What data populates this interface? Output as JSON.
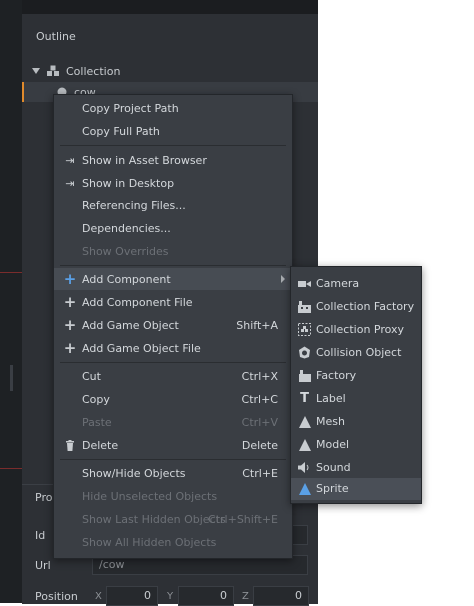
{
  "outline": {
    "title": "Outline",
    "collection_label": "Collection",
    "cow_label": "cow"
  },
  "properties": {
    "title": "Pro",
    "id_label": "Id",
    "url_label": "Url",
    "url_value": "/cow",
    "position_label": "Position",
    "x_label": "X",
    "y_label": "Y",
    "z_label": "Z",
    "x_value": "0",
    "y_value": "0",
    "z_value": "0"
  },
  "context_menu": {
    "copy_project_path": "Copy Project Path",
    "copy_full_path": "Copy Full Path",
    "show_in_asset_browser": "Show in Asset Browser",
    "show_in_desktop": "Show in Desktop",
    "referencing_files": "Referencing Files...",
    "dependencies": "Dependencies...",
    "show_overrides": "Show Overrides",
    "add_component": "Add Component",
    "add_component_file": "Add Component File",
    "add_game_object": "Add Game Object",
    "add_game_object_shortcut": "Shift+A",
    "add_game_object_file": "Add Game Object File",
    "cut": "Cut",
    "cut_shortcut": "Ctrl+X",
    "copy": "Copy",
    "copy_shortcut": "Ctrl+C",
    "paste": "Paste",
    "paste_shortcut": "Ctrl+V",
    "delete": "Delete",
    "delete_shortcut": "Delete",
    "show_hide_objects": "Show/Hide Objects",
    "show_hide_shortcut": "Ctrl+E",
    "hide_unselected": "Hide Unselected Objects",
    "show_last_hidden": "Show Last Hidden Objects",
    "show_last_hidden_shortcut": "Ctrl+Shift+E",
    "show_all_hidden": "Show All Hidden Objects"
  },
  "submenu": {
    "camera": "Camera",
    "collection_factory": "Collection Factory",
    "collection_proxy": "Collection Proxy",
    "collision_object": "Collision Object",
    "factory": "Factory",
    "label": "Label",
    "mesh": "Mesh",
    "model": "Model",
    "sound": "Sound",
    "sprite": "Sprite"
  },
  "colors": {
    "accent_blue": "#5aa0e6",
    "selection_orange": "#e08a2c",
    "panel_bg": "#2d3035",
    "menu_bg": "#3a3e44"
  }
}
